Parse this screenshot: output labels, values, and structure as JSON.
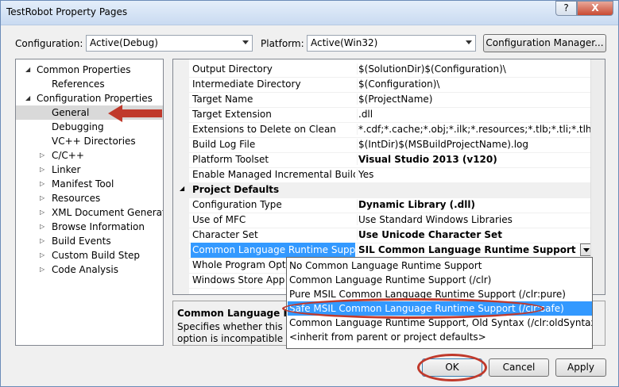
{
  "window": {
    "title": "TestRobot Property Pages",
    "help_glyph": "?",
    "close_glyph": "X"
  },
  "toolbar": {
    "configuration_label": "Configuration:",
    "configuration_value": "Active(Debug)",
    "platform_label": "Platform:",
    "platform_value": "Active(Win32)",
    "config_manager_label": "Configuration Manager..."
  },
  "tree": [
    {
      "label": "Common Properties",
      "toggle": "◢"
    },
    {
      "label": "References",
      "toggle": ""
    },
    {
      "label": "Configuration Properties",
      "toggle": "◢"
    },
    {
      "label": "General",
      "toggle": "",
      "selected": true
    },
    {
      "label": "Debugging",
      "toggle": ""
    },
    {
      "label": "VC++ Directories",
      "toggle": ""
    },
    {
      "label": "C/C++",
      "toggle": "▷"
    },
    {
      "label": "Linker",
      "toggle": "▷"
    },
    {
      "label": "Manifest Tool",
      "toggle": "▷"
    },
    {
      "label": "Resources",
      "toggle": "▷"
    },
    {
      "label": "XML Document Generator",
      "toggle": "▷"
    },
    {
      "label": "Browse Information",
      "toggle": "▷"
    },
    {
      "label": "Build Events",
      "toggle": "▷"
    },
    {
      "label": "Custom Build Step",
      "toggle": "▷"
    },
    {
      "label": "Code Analysis",
      "toggle": "▷"
    }
  ],
  "grid": {
    "rows": [
      {
        "name": "Output Directory",
        "value": "$(SolutionDir)$(Configuration)\\"
      },
      {
        "name": "Intermediate Directory",
        "value": "$(Configuration)\\"
      },
      {
        "name": "Target Name",
        "value": "$(ProjectName)"
      },
      {
        "name": "Target Extension",
        "value": ".dll"
      },
      {
        "name": "Extensions to Delete on Clean",
        "value": "*.cdf;*.cache;*.obj;*.ilk;*.resources;*.tlb;*.tli;*.tlh;*.tmp;*.rsp;*.pgc;*.pgd;*.meta"
      },
      {
        "name": "Build Log File",
        "value": "$(IntDir)$(MSBuildProjectName).log"
      },
      {
        "name": "Platform Toolset",
        "value": "Visual Studio 2013 (v120)",
        "bold": true
      },
      {
        "name": "Enable Managed Incremental Build",
        "value": "Yes"
      }
    ],
    "section": {
      "label": "Project Defaults",
      "toggle": "◢"
    },
    "project_rows": [
      {
        "name": "Configuration Type",
        "value": "Dynamic Library (.dll)",
        "bold": true
      },
      {
        "name": "Use of MFC",
        "value": "Use Standard Windows Libraries"
      },
      {
        "name": "Character Set",
        "value": "Use Unicode Character Set",
        "bold": true
      },
      {
        "name": "Common Language Runtime Support",
        "value": "SIL Common Language Runtime Support (/clr:safe)",
        "bold": true,
        "selected": true
      },
      {
        "name": "Whole Program Optimization",
        "value": ""
      },
      {
        "name": "Windows Store App Support",
        "value": ""
      }
    ]
  },
  "dropdown": {
    "options": [
      {
        "label": "No Common Language Runtime Support"
      },
      {
        "label": "Common Language Runtime Support (/clr)"
      },
      {
        "label": "Pure MSIL Common Language Runtime Support (/clr:pure)"
      },
      {
        "label": "Safe MSIL Common Language Runtime Support (/clr:safe)",
        "highlighted": true
      },
      {
        "label": "Common Language Runtime Support, Old Syntax (/clr:oldSyntax)"
      },
      {
        "label": "<inherit from parent or project defaults>"
      }
    ]
  },
  "description": {
    "title": "Common Language Runtime Support",
    "text": "Specifies whether this configuration supports the Common Language Runtime. This option is incompatible with some other settings, including"
  },
  "buttons": {
    "ok": "OK",
    "cancel": "Cancel",
    "apply": "Apply"
  },
  "colors": {
    "selection": "#3399ff",
    "annotation": "#c0392b",
    "tree_selected": "#d9d9d9"
  }
}
